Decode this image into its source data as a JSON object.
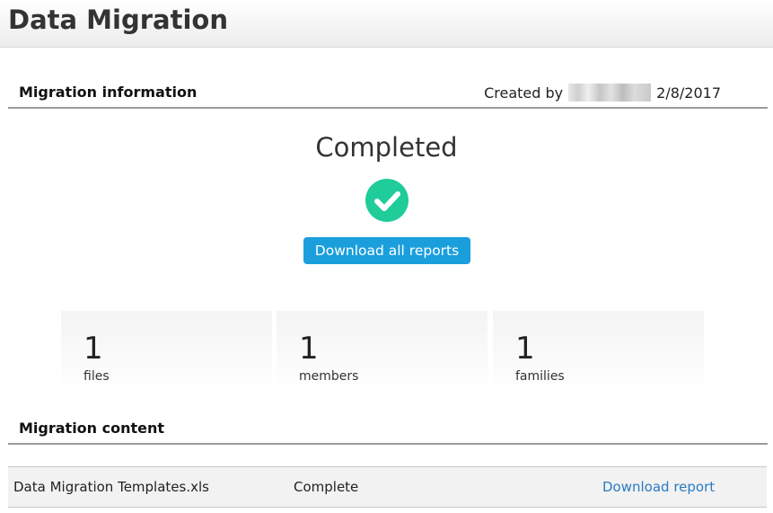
{
  "page": {
    "title": "Data Migration"
  },
  "info": {
    "section_title": "Migration information",
    "created_prefix": "Created by",
    "created_date": "2/8/2017"
  },
  "status": {
    "label": "Completed",
    "icon": "check-circle-icon",
    "icon_color": "#1fcc9a",
    "download_all_label": "Download all reports",
    "button_color": "#1a9fdc"
  },
  "stats": [
    {
      "value": "1",
      "label": "files"
    },
    {
      "value": "1",
      "label": "members"
    },
    {
      "value": "1",
      "label": "families"
    }
  ],
  "content": {
    "section_title": "Migration content",
    "rows": [
      {
        "file": "Data Migration Templates.xls",
        "status": "Complete",
        "action": "Download report"
      }
    ]
  }
}
